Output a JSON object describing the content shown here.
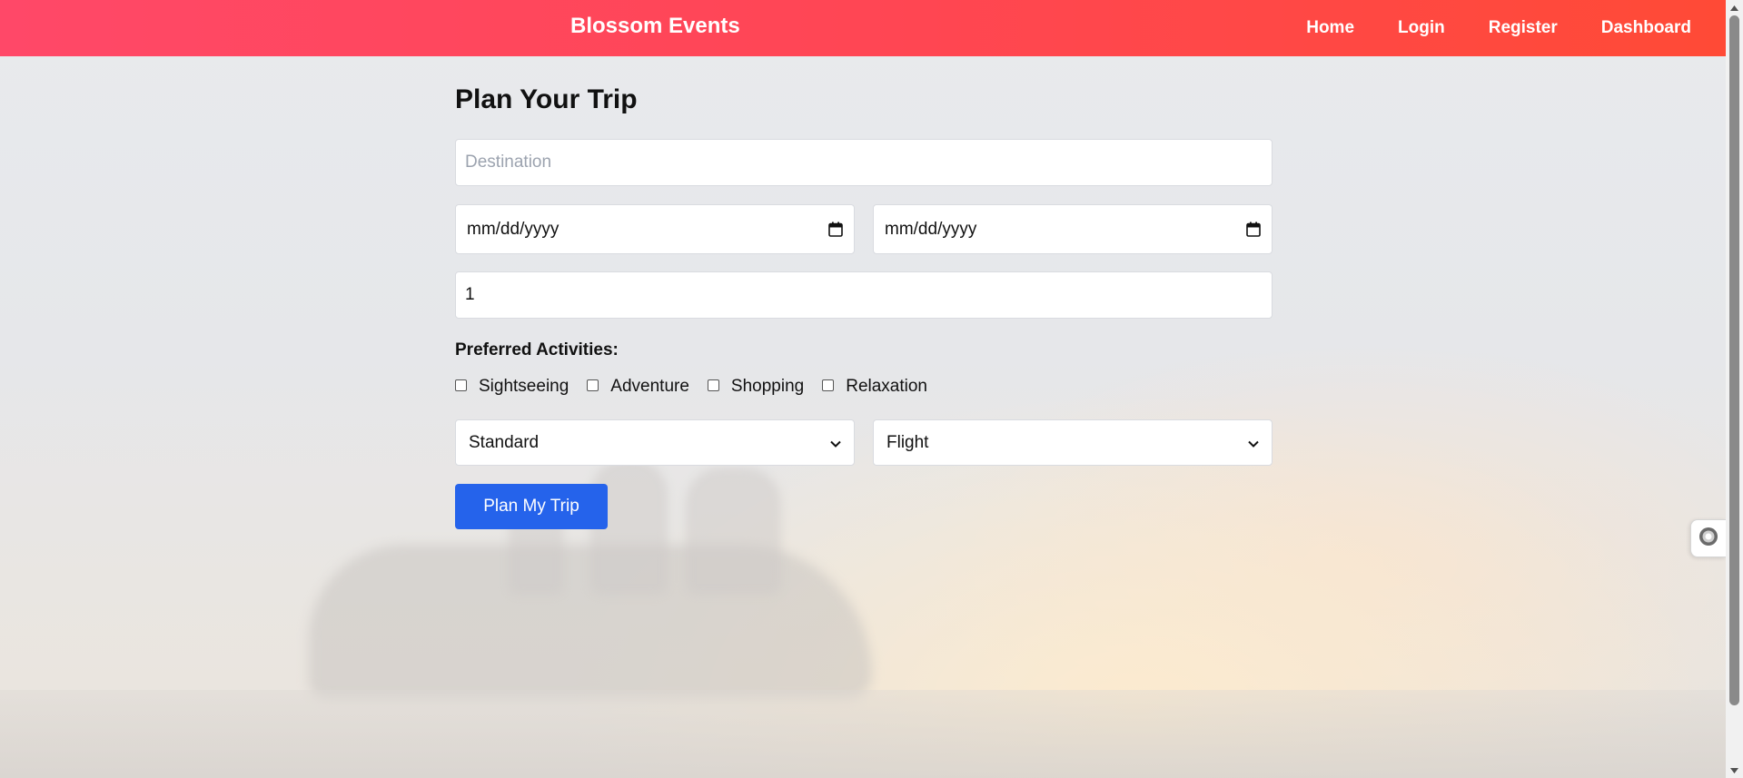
{
  "header": {
    "brand": "Blossom Events",
    "nav": [
      "Home",
      "Login",
      "Register",
      "Dashboard"
    ],
    "colors": {
      "gradient_start": "#ff4868",
      "gradient_end": "#ff4a36"
    }
  },
  "form": {
    "title": "Plan Your Trip",
    "destination_placeholder": "Destination",
    "start_date": "mm/dd/yyyy",
    "end_date": "mm/dd/yyyy",
    "travelers": "1",
    "activities_label": "Preferred Activities:",
    "activities": [
      "Sightseeing",
      "Adventure",
      "Shopping",
      "Relaxation"
    ],
    "package_select": "Standard",
    "transport_select": "Flight",
    "submit_label": "Plan My Trip",
    "submit_color": "#2563eb"
  },
  "icons": {
    "date": "calendar-icon",
    "select": "chevron-down-icon",
    "widget": "assistant-icon"
  }
}
